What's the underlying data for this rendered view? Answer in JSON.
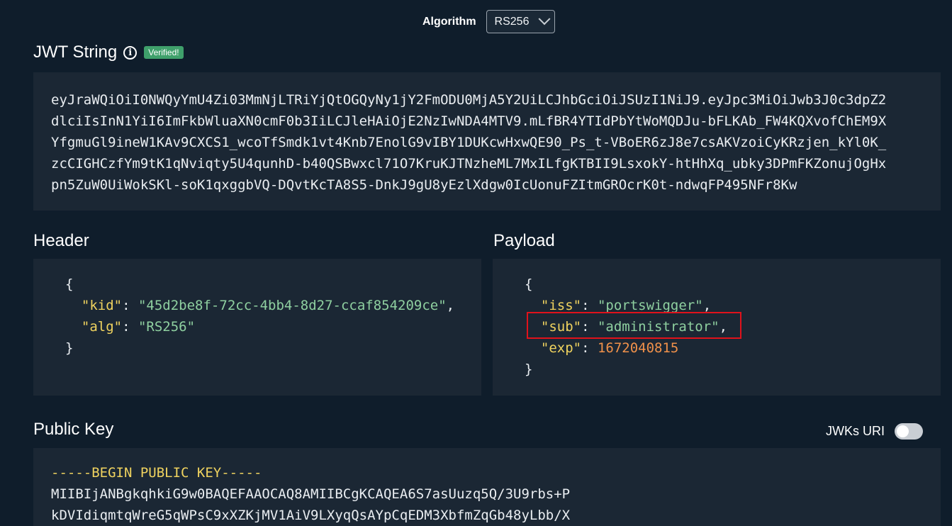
{
  "algorithm": {
    "label": "Algorithm",
    "selected": "RS256"
  },
  "jwt": {
    "title": "JWT String",
    "badge": "Verified!",
    "lines": [
      "eyJraWQiOiI0NWQyYmU4Zi03MmNjLTRiYjQtOGQyNy1jY2FmODU0MjA5Y2UiLCJhbGciOiJSUzI1NiJ9.eyJpc3MiOiJwb3J0c3dpZ2",
      "dlciIsInN1YiI6ImFkbWluaXN0cmF0b3IiLCJleHAiOjE2NzIwNDA4MTV9.mLfBR4YTIdPbYtWoMQDJu-bFLKAb_FW4KQXvofChEM9X",
      "YfgmuGl9ineW1KAv9CXCS1_wcoTfSmdk1vt4Knb7EnolG9vIBY1DUKcwHxwQE90_Ps_t-VBoER6zJ8e7csAKVzoiCyKRzjen_kYl0K_",
      "zcCIGHCzfYm9tK1qNviqty5U4qunhD-b40QSBwxcl71O7KruKJTNzheML7MxILfgKTBII9LsxokY-htHhXq_ubky3DPmFKZonujOgHx",
      "pn5ZuW0UiWokSKl-soK1qxggbVQ-DQvtKcTA8S5-DnkJ9gU8yEzlXdgw0IcUonuFZItmGROcrK0t-ndwqFP495NFr8Kw"
    ]
  },
  "header": {
    "title": "Header",
    "open_brace": "{",
    "close_brace": "}",
    "fields": [
      {
        "key": "\"kid\"",
        "value": "\"45d2be8f-72cc-4bb4-8d27-ccaf854209ce\"",
        "trail": ","
      },
      {
        "key": "\"alg\"",
        "value": "\"RS256\"",
        "trail": ""
      }
    ]
  },
  "payload": {
    "title": "Payload",
    "open_brace": "{",
    "close_brace": "}",
    "fields": [
      {
        "key": "\"iss\"",
        "value": "\"portswigger\"",
        "trail": ",",
        "type": "string"
      },
      {
        "key": "\"sub\"",
        "value": "\"administrator\"",
        "trail": ",",
        "type": "string"
      },
      {
        "key": "\"exp\"",
        "value": "1672040815",
        "trail": "",
        "type": "number"
      }
    ]
  },
  "public_key": {
    "title": "Public Key",
    "jwks_label": "JWKs URI",
    "jwks_enabled": false,
    "lines": [
      "-----BEGIN PUBLIC KEY-----",
      "MIIBIjANBgkqhkiG9w0BAQEFAAOCAQ8AMIIBCgKCAQEA6S7asUuzq5Q/3U9rbs+P",
      "kDVIdiqmtqWreG5qWPsC9xXZKjMV1AiV9LXyqQsAYpCqEDM3XbfmZqGb48yLbb/X"
    ]
  },
  "colors": {
    "background": "#0f1d2b",
    "panel": "#1b2734",
    "key": "#f0d35f",
    "string": "#8fd0a0",
    "number": "#f0914a",
    "badge": "#3fa06b",
    "highlight": "#e0121b"
  }
}
